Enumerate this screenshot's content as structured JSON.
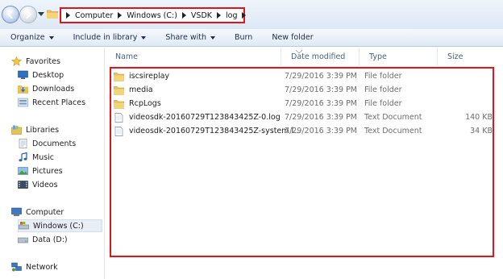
{
  "address": {
    "breadcrumbs": [
      "Computer",
      "Windows (C:)",
      "VSDK",
      "log"
    ]
  },
  "toolbar": {
    "organize": "Organize",
    "include_in_library": "Include in library",
    "share_with": "Share with",
    "burn": "Burn",
    "new_folder": "New folder"
  },
  "nav": {
    "favorites": "Favorites",
    "desktop": "Desktop",
    "downloads": "Downloads",
    "recent_places": "Recent Places",
    "libraries": "Libraries",
    "documents": "Documents",
    "music": "Music",
    "pictures": "Pictures",
    "videos": "Videos",
    "computer": "Computer",
    "windows_c": "Windows (C:)",
    "data_d": "Data (D:)",
    "network": "Network"
  },
  "columns": {
    "name": "Name",
    "date_modified": "Date modified",
    "type": "Type",
    "size": "Size"
  },
  "files": [
    {
      "name": "iscsireplay",
      "date": "7/29/2016 3:39 PM",
      "type": "File folder",
      "size": "",
      "kind": "folder"
    },
    {
      "name": "media",
      "date": "7/29/2016 3:39 PM",
      "type": "File folder",
      "size": "",
      "kind": "folder"
    },
    {
      "name": "RcpLogs",
      "date": "7/29/2016 3:39 PM",
      "type": "File folder",
      "size": "",
      "kind": "folder"
    },
    {
      "name": "videosdk-20160729T123843425Z-0.log",
      "date": "7/29/2016 3:39 PM",
      "type": "Text Document",
      "size": "140 KB",
      "kind": "document"
    },
    {
      "name": "videosdk-20160729T123843425Z-system.l...",
      "date": "7/29/2016 3:39 PM",
      "type": "Text Document",
      "size": "34 KB",
      "kind": "document"
    }
  ],
  "colors": {
    "highlight": "#e2141a",
    "folder": "#e8c15a",
    "selection": "#e8eef5"
  }
}
